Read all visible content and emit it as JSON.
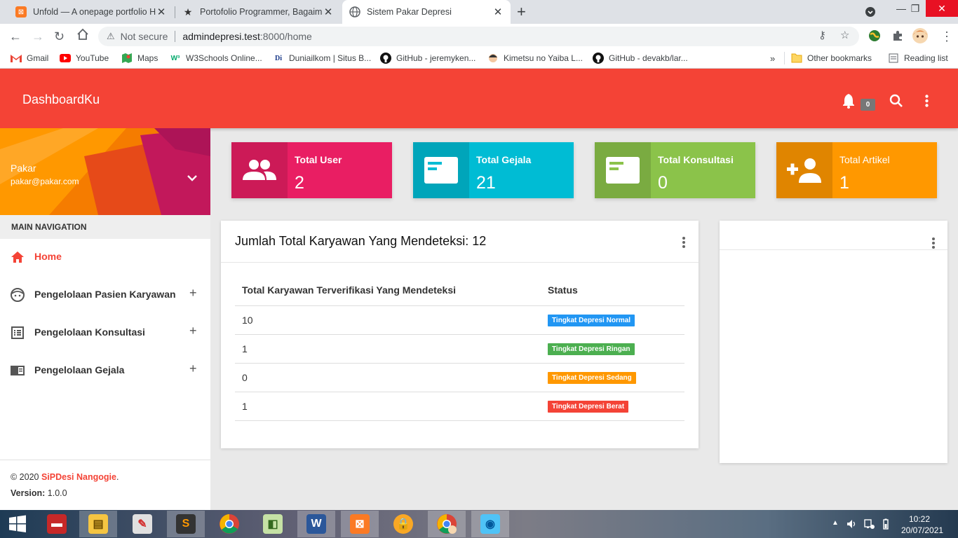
{
  "browser": {
    "tabs": [
      {
        "title": "Unfold — A onepage portfolio H",
        "icon": "xampp-icon",
        "color": "#fb7a24"
      },
      {
        "title": "Portofolio Programmer, Bagaima",
        "icon": "star-icon",
        "color": "#333333"
      },
      {
        "title": "Sistem Pakar Depresi",
        "icon": "globe-icon",
        "color": "#5f6368"
      }
    ],
    "address": {
      "security": "Not secure",
      "host": "admindepresi.test",
      "path": ":8000/home"
    },
    "bookmarks": [
      {
        "label": "Gmail",
        "icon": "gmail-icon"
      },
      {
        "label": "YouTube",
        "icon": "youtube-icon"
      },
      {
        "label": "Maps",
        "icon": "maps-icon"
      },
      {
        "label": "W3Schools Online...",
        "icon": "w3schools-icon"
      },
      {
        "label": "Duniailkom | Situs B...",
        "icon": "duniailkom-icon"
      },
      {
        "label": "GitHub - jeremyken...",
        "icon": "github-icon"
      },
      {
        "label": "Kimetsu no Yaiba L...",
        "icon": "anime-icon"
      },
      {
        "label": "GitHub - devakb/lar...",
        "icon": "github-icon"
      }
    ],
    "bookmarks_more": "»",
    "other_bookmarks": "Other bookmarks",
    "reading_list": "Reading list"
  },
  "header": {
    "brand": "DashboardKu",
    "notif_count": "0"
  },
  "sidebar": {
    "user_name": "Pakar",
    "user_email": "pakar@pakar.com",
    "nav_heading": "MAIN NAVIGATION",
    "items": [
      {
        "label": "Home",
        "icon": "home-icon"
      },
      {
        "label": "Pengelolaan Pasien Karyawan",
        "icon": "face-icon"
      },
      {
        "label": "Pengelolaan Konsultasi",
        "icon": "list-icon"
      },
      {
        "label": "Pengelolaan Gejala",
        "icon": "chrome-reader-icon"
      }
    ],
    "footer": {
      "copyright_prefix": "© 2020 ",
      "copyright_link": "SiPDesi Nangogie",
      "copyright_suffix": ".",
      "version_label": "Version:",
      "version_value": " 1.0.0"
    }
  },
  "stats": [
    {
      "title": "Total User",
      "value": "2",
      "color": "#e91e63",
      "icon": "people-icon"
    },
    {
      "title": "Total Gejala",
      "value": "21",
      "color": "#00bcd4",
      "icon": "card-icon"
    },
    {
      "title": "Total Konsultasi",
      "value": "0",
      "color": "#8bc34a",
      "icon": "card-icon"
    },
    {
      "title": "Total Artikel",
      "value": "1",
      "color": "#ff9800",
      "icon": "person-add-icon"
    }
  ],
  "detection_card": {
    "title": "Jumlah Total Karyawan Yang Mendeteksi: 12",
    "columns": [
      "Total Karyawan Terverifikasi Yang Mendeteksi",
      "Status"
    ],
    "rows": [
      {
        "count": "10",
        "status": "Tingkat Depresi Normal",
        "color": "#2196f3"
      },
      {
        "count": "1",
        "status": "Tingkat Depresi Ringan",
        "color": "#4caf50"
      },
      {
        "count": "0",
        "status": "Tingkat Depresi Sedang",
        "color": "#ff9800"
      },
      {
        "count": "1",
        "status": "Tingkat Depresi Berat",
        "color": "#f44336"
      }
    ]
  },
  "taskbar": {
    "apps": [
      "start",
      "book",
      "file-explorer",
      "paint",
      "sublime",
      "chrome",
      "sticky",
      "word",
      "xampp",
      "vpn",
      "chrome-profile",
      "mysql"
    ],
    "time": "10:22",
    "date": "20/07/2021"
  },
  "colors": {
    "accent": "#f44336"
  }
}
